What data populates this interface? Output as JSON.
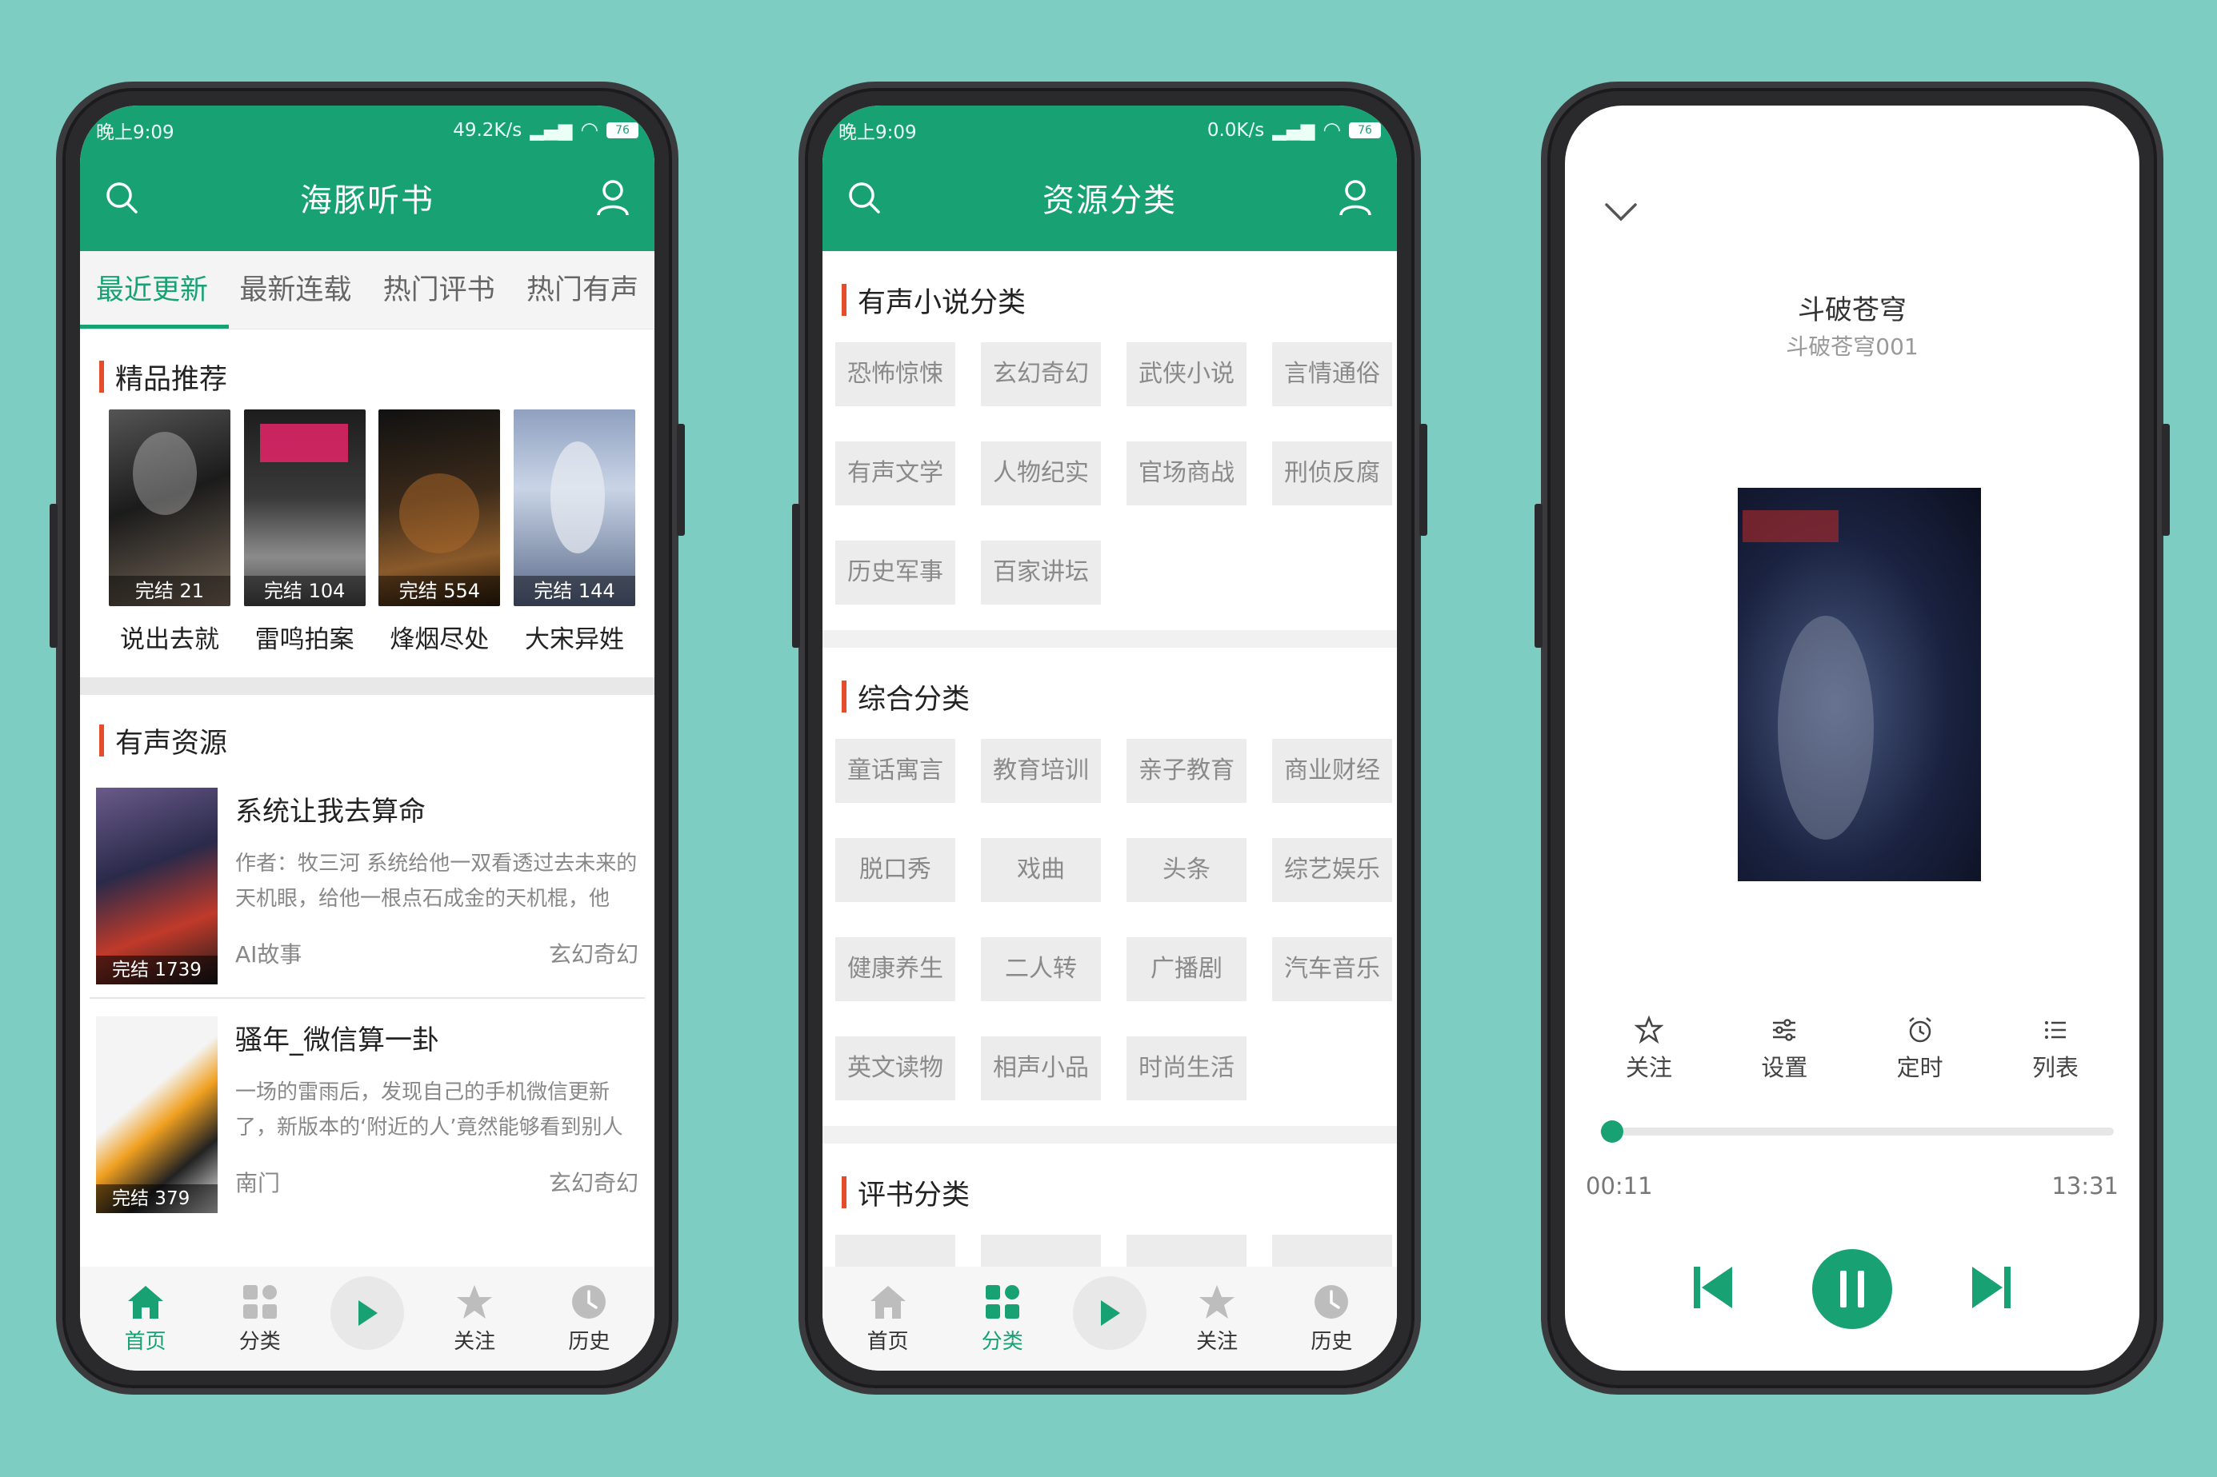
{
  "colors": {
    "accent": "#18a274",
    "accent_bar": "#e44c2c",
    "background": "#7ecdc2"
  },
  "screen1": {
    "status": {
      "time": "晚上9:09",
      "speed": "49.2K/s",
      "battery": "76"
    },
    "title": "海豚听书",
    "tabs": [
      "最近更新",
      "最新连载",
      "热门评书",
      "热门有声"
    ],
    "featured_title": "精品推荐",
    "featured": [
      {
        "badge": "完结 21",
        "name": "说出去就"
      },
      {
        "badge": "完结 104",
        "name": "雷鸣拍案"
      },
      {
        "badge": "完结 554",
        "name": "烽烟尽处"
      },
      {
        "badge": "完结 144",
        "name": "大宋异姓"
      }
    ],
    "resources_title": "有声资源",
    "resources": [
      {
        "title": "系统让我去算命",
        "desc": "作者：牧三河 系统给他一双看透过去未来的天机眼，给他一根点石成金的天机棍，他却...",
        "badge": "完结 1739",
        "source": "AI故事",
        "genre": "玄幻奇幻"
      },
      {
        "title": "骚年_微信算一卦",
        "desc": "一场的雷雨后，发现自己的手机微信更新了，新版本的‘附近的人’竟然能够看到别人的...",
        "badge": "完结 379",
        "source": "南门",
        "genre": "玄幻奇幻"
      }
    ],
    "nav": [
      "首页",
      "分类",
      "关注",
      "历史"
    ]
  },
  "screen2": {
    "status": {
      "time": "晚上9:09",
      "speed": "0.0K/s",
      "battery": "76"
    },
    "title": "资源分类",
    "sections": [
      {
        "title": "有声小说分类",
        "items": [
          "恐怖惊悚",
          "玄幻奇幻",
          "武侠小说",
          "言情通俗",
          "有声文学",
          "人物纪实",
          "官场商战",
          "刑侦反腐",
          "历史军事",
          "百家讲坛"
        ]
      },
      {
        "title": "综合分类",
        "items": [
          "童话寓言",
          "教育培训",
          "亲子教育",
          "商业财经",
          "脱口秀",
          "戏曲",
          "头条",
          "综艺娱乐",
          "健康养生",
          "二人转",
          "广播剧",
          "汽车音乐",
          "英文读物",
          "相声小品",
          "时尚生活"
        ]
      },
      {
        "title": "评书分类"
      }
    ],
    "nav": [
      "首页",
      "分类",
      "关注",
      "历史"
    ]
  },
  "screen3": {
    "title": "斗破苍穹",
    "subtitle": "斗破苍穹001",
    "actions": [
      "关注",
      "设置",
      "定时",
      "列表"
    ],
    "elapsed": "00:11",
    "duration": "13:31",
    "progress": 0.014
  }
}
